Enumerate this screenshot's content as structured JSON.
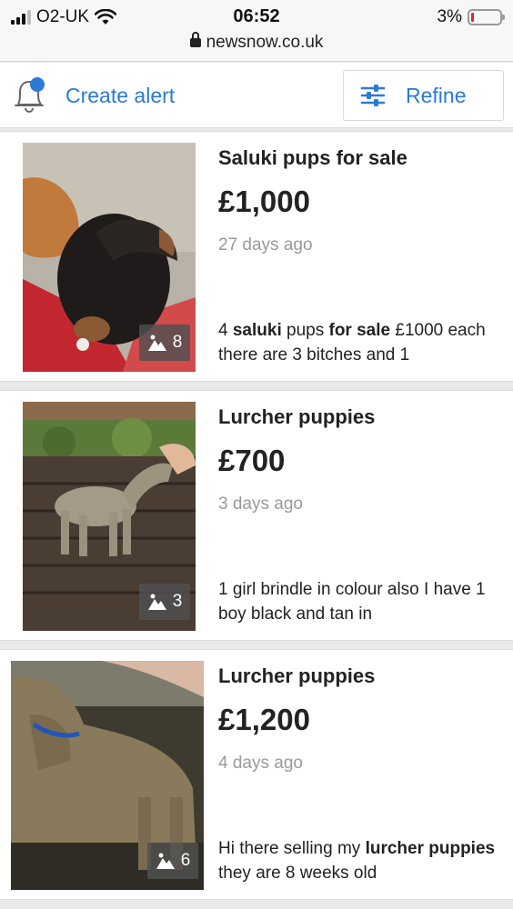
{
  "status_bar": {
    "carrier": "O2-UK",
    "time": "06:52",
    "battery": "3%"
  },
  "browser": {
    "url": "newsnow.co.uk"
  },
  "toolbar": {
    "create_alert_label": "Create alert",
    "refine_label": "Refine"
  },
  "colors": {
    "accent": "#2a7ad6",
    "muted": "#9a9a9a",
    "battery_low": "#e0282e"
  },
  "listings": [
    {
      "title": "Saluki pups for sale",
      "price": "£1,000",
      "age": "27 days ago",
      "photo_count": "8",
      "desc_parts": [
        {
          "t": "4 ",
          "b": false
        },
        {
          "t": "saluki",
          "b": true
        },
        {
          "t": " pups ",
          "b": false
        },
        {
          "t": "for sale",
          "b": true
        },
        {
          "t": " £1000 each there are 3 bitches and 1",
          "b": false
        }
      ]
    },
    {
      "title": "Lurcher puppies",
      "price": "£700",
      "age": "3 days ago",
      "photo_count": "3",
      "desc_parts": [
        {
          "t": "1 girl brindle in colour also I have 1 boy black and tan in",
          "b": false
        }
      ]
    },
    {
      "title": "Lurcher puppies",
      "price": "£1,200",
      "age": "4 days ago",
      "photo_count": "6",
      "desc_parts": [
        {
          "t": "Hi there selling my ",
          "b": false
        },
        {
          "t": "lurcher puppies",
          "b": true
        },
        {
          "t": " they are 8 weeks old",
          "b": false
        }
      ]
    }
  ]
}
